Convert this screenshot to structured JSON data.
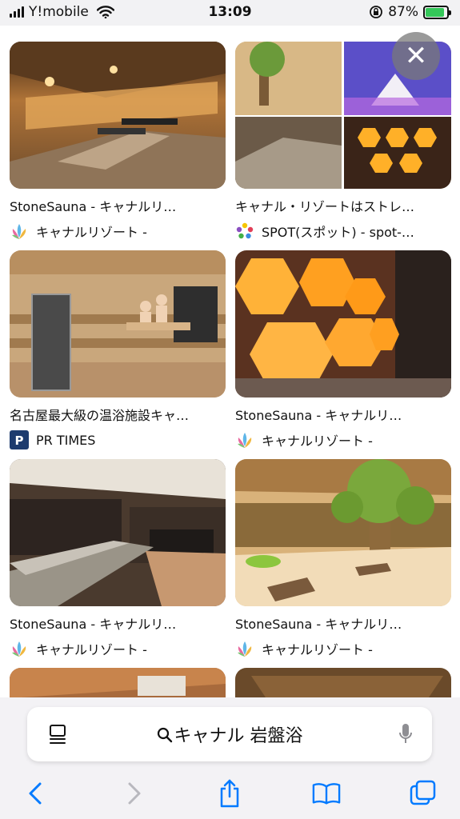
{
  "status_bar": {
    "carrier": "Y!mobile",
    "time": "13:09",
    "battery_percent": "87%",
    "battery_level": 0.87
  },
  "results": [
    {
      "title": "StoneSauna - キャナルリ…",
      "source": "キャナルリゾート -"
    },
    {
      "title": "キャナル・リゾートはストレ…",
      "source": "SPOT(スポット) - spot-…"
    },
    {
      "title": "名古屋最大級の温浴施設キャ…",
      "source": "PR TIMES"
    },
    {
      "title": "StoneSauna - キャナルリ…",
      "source": "キャナルリゾート -"
    },
    {
      "title": "StoneSauna - キャナルリ…",
      "source": "キャナルリゾート -"
    },
    {
      "title": "StoneSauna - キャナルリ…",
      "source": "キャナルリゾート -"
    }
  ],
  "overlay": {
    "close_label": "✕"
  },
  "address_bar": {
    "query": "キャナル 岩盤浴"
  },
  "icons": {
    "search": "search-icon",
    "tabs_menu": "page-menu-icon",
    "mic": "microphone-icon",
    "back": "chevron-left-icon",
    "forward": "chevron-right-icon",
    "share": "share-icon",
    "bookmarks": "bookmarks-icon",
    "tabs": "tabs-icon"
  },
  "colors": {
    "accent": "#007aff",
    "battery": "#34c759"
  }
}
